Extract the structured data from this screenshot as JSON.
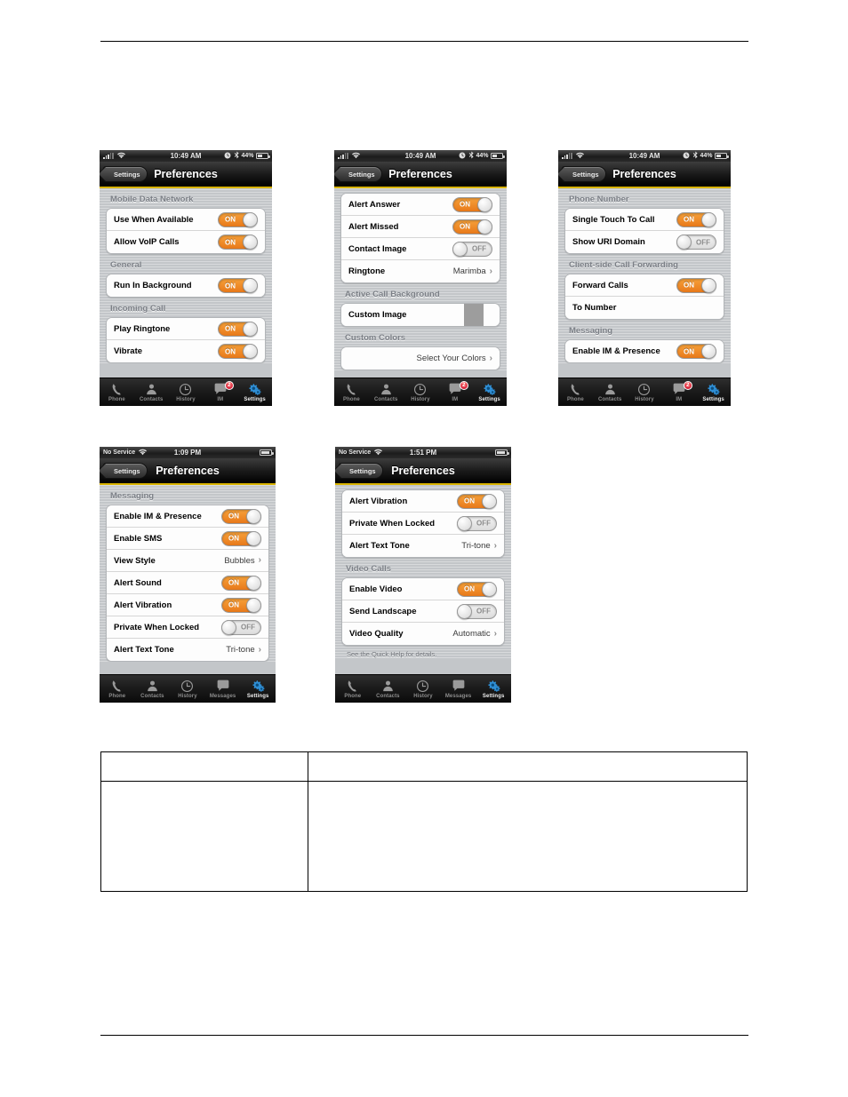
{
  "document": {
    "has_header_rule": true,
    "has_footer_rule": true,
    "table": {
      "columns": [
        "",
        ""
      ],
      "rows": [
        [
          "",
          ""
        ]
      ]
    }
  },
  "icons": {
    "wifi": "wifi-icon",
    "bluetooth": "bluetooth-icon",
    "alarm": "alarm-clock-icon",
    "battery": "battery-icon",
    "chevron": "chevron-right-icon",
    "phone": "phone-handset-icon",
    "contacts": "person-icon",
    "history": "clock-icon",
    "messages": "speech-bubble-icon",
    "settings": "gears-icon"
  },
  "colors": {
    "toggle_on": "#e8791a",
    "toggle_off": "#dcdcdc",
    "navbar_accent": "#d9b400",
    "list_background": "#c3c6c9",
    "badge": "#c8102e"
  },
  "screens": [
    {
      "id": "screen-1-preferences-mobile-data",
      "status": {
        "carrier": "",
        "signal": "signal-bars-icon",
        "wifi": "wifi-icon",
        "time": "10:49 AM",
        "alarm": "alarm-icon",
        "bluetooth": "bluetooth-icon",
        "battery_pct": "44%"
      },
      "nav": {
        "back_label": "Settings",
        "title": "Preferences"
      },
      "groups": [
        {
          "header": "Mobile Data Network",
          "rows": [
            {
              "label": "Use When Available",
              "control": "toggle",
              "state": "ON"
            },
            {
              "label": "Allow VoIP Calls",
              "control": "toggle",
              "state": "ON"
            }
          ]
        },
        {
          "header": "General",
          "rows": [
            {
              "label": "Run In Background",
              "control": "toggle",
              "state": "ON"
            }
          ]
        },
        {
          "header": "Incoming Call",
          "rows": [
            {
              "label": "Play Ringtone",
              "control": "toggle",
              "state": "ON"
            },
            {
              "label": "Vibrate",
              "control": "toggle",
              "state": "ON"
            }
          ]
        }
      ],
      "tabs": [
        {
          "label": "Phone",
          "icon": "phone-handset-icon",
          "active": false,
          "badge": ""
        },
        {
          "label": "Contacts",
          "icon": "person-icon",
          "active": false,
          "badge": ""
        },
        {
          "label": "History",
          "icon": "clock-icon",
          "active": false,
          "badge": ""
        },
        {
          "label": "IM",
          "icon": "speech-bubble-icon",
          "active": false,
          "badge": "2"
        },
        {
          "label": "Settings",
          "icon": "gears-icon",
          "active": true,
          "badge": ""
        }
      ]
    },
    {
      "id": "screen-2-preferences-alerts",
      "status": {
        "carrier": "",
        "time": "10:49 AM",
        "battery_pct": "44%"
      },
      "nav": {
        "back_label": "Settings",
        "title": "Preferences"
      },
      "groups": [
        {
          "header": "",
          "rows": [
            {
              "label": "Alert Answer",
              "control": "toggle",
              "state": "ON"
            },
            {
              "label": "Alert Missed",
              "control": "toggle",
              "state": "ON"
            },
            {
              "label": "Contact Image",
              "control": "toggle",
              "state": "OFF"
            },
            {
              "label": "Ringtone",
              "control": "value",
              "value": "Marimba",
              "chevron": true
            }
          ]
        },
        {
          "header": "Active Call Background",
          "rows": [
            {
              "label": "Custom Image",
              "control": "swatch"
            }
          ]
        },
        {
          "header": "Custom Colors",
          "rows": [
            {
              "label": "",
              "control": "value",
              "value": "Select Your Colors",
              "chevron": true
            }
          ]
        }
      ],
      "tabs": [
        {
          "label": "Phone",
          "icon": "phone-handset-icon",
          "active": false,
          "badge": ""
        },
        {
          "label": "Contacts",
          "icon": "person-icon",
          "active": false,
          "badge": ""
        },
        {
          "label": "History",
          "icon": "clock-icon",
          "active": false,
          "badge": ""
        },
        {
          "label": "IM",
          "icon": "speech-bubble-icon",
          "active": false,
          "badge": "2"
        },
        {
          "label": "Settings",
          "icon": "gears-icon",
          "active": true,
          "badge": ""
        }
      ]
    },
    {
      "id": "screen-3-preferences-phone-number",
      "status": {
        "carrier": "",
        "time": "10:49 AM",
        "battery_pct": "44%"
      },
      "nav": {
        "back_label": "Settings",
        "title": "Preferences"
      },
      "groups": [
        {
          "header": "Phone Number",
          "rows": [
            {
              "label": "Single Touch To Call",
              "control": "toggle",
              "state": "ON"
            },
            {
              "label": "Show URI Domain",
              "control": "toggle",
              "state": "OFF"
            }
          ]
        },
        {
          "header": "Client-side Call Forwarding",
          "rows": [
            {
              "label": "Forward Calls",
              "control": "toggle",
              "state": "ON"
            },
            {
              "label": "To Number",
              "control": "none"
            }
          ]
        },
        {
          "header": "Messaging",
          "rows": [
            {
              "label": "Enable IM & Presence",
              "control": "toggle",
              "state": "ON"
            }
          ]
        }
      ],
      "tabs": [
        {
          "label": "Phone",
          "icon": "phone-handset-icon",
          "active": false,
          "badge": ""
        },
        {
          "label": "Contacts",
          "icon": "person-icon",
          "active": false,
          "badge": ""
        },
        {
          "label": "History",
          "icon": "clock-icon",
          "active": false,
          "badge": ""
        },
        {
          "label": "IM",
          "icon": "speech-bubble-icon",
          "active": false,
          "badge": "2"
        },
        {
          "label": "Settings",
          "icon": "gears-icon",
          "active": true,
          "badge": ""
        }
      ]
    },
    {
      "id": "screen-4-preferences-messaging",
      "status": {
        "carrier": "No Service",
        "time": "1:09 PM",
        "battery_pct": ""
      },
      "nav": {
        "back_label": "Settings",
        "title": "Preferences"
      },
      "groups": [
        {
          "header": "Messaging",
          "rows": [
            {
              "label": "Enable IM & Presence",
              "control": "toggle",
              "state": "ON"
            },
            {
              "label": "Enable SMS",
              "control": "toggle",
              "state": "ON"
            },
            {
              "label": "View Style",
              "control": "value",
              "value": "Bubbles",
              "chevron": true
            },
            {
              "label": "Alert Sound",
              "control": "toggle",
              "state": "ON"
            },
            {
              "label": "Alert Vibration",
              "control": "toggle",
              "state": "ON"
            },
            {
              "label": "Private When Locked",
              "control": "toggle",
              "state": "OFF"
            },
            {
              "label": "Alert Text Tone",
              "control": "value",
              "value": "Tri-tone",
              "chevron": true
            }
          ]
        }
      ],
      "tabs": [
        {
          "label": "Phone",
          "icon": "phone-handset-icon",
          "active": false,
          "badge": ""
        },
        {
          "label": "Contacts",
          "icon": "person-icon",
          "active": false,
          "badge": ""
        },
        {
          "label": "History",
          "icon": "clock-icon",
          "active": false,
          "badge": ""
        },
        {
          "label": "Messages",
          "icon": "speech-bubble-icon",
          "active": false,
          "badge": ""
        },
        {
          "label": "Settings",
          "icon": "gears-icon",
          "active": true,
          "badge": ""
        }
      ]
    },
    {
      "id": "screen-5-preferences-video-calls",
      "status": {
        "carrier": "No Service",
        "time": "1:51 PM",
        "battery_pct": ""
      },
      "nav": {
        "back_label": "Settings",
        "title": "Preferences"
      },
      "groups": [
        {
          "header": "",
          "rows": [
            {
              "label": "Alert Vibration",
              "control": "toggle",
              "state": "ON"
            },
            {
              "label": "Private When Locked",
              "control": "toggle",
              "state": "OFF"
            },
            {
              "label": "Alert Text Tone",
              "control": "value",
              "value": "Tri-tone",
              "chevron": true
            }
          ]
        },
        {
          "header": "Video Calls",
          "rows": [
            {
              "label": "Enable Video",
              "control": "toggle",
              "state": "ON"
            },
            {
              "label": "Send Landscape",
              "control": "toggle",
              "state": "OFF"
            },
            {
              "label": "Video Quality",
              "control": "value",
              "value": "Automatic",
              "chevron": true
            }
          ]
        }
      ],
      "footnote": "See the Quick Help for details.",
      "tabs": [
        {
          "label": "Phone",
          "icon": "phone-handset-icon",
          "active": false,
          "badge": ""
        },
        {
          "label": "Contacts",
          "icon": "person-icon",
          "active": false,
          "badge": ""
        },
        {
          "label": "History",
          "icon": "clock-icon",
          "active": false,
          "badge": ""
        },
        {
          "label": "Messages",
          "icon": "speech-bubble-icon",
          "active": false,
          "badge": ""
        },
        {
          "label": "Settings",
          "icon": "gears-icon",
          "active": true,
          "badge": ""
        }
      ]
    }
  ]
}
